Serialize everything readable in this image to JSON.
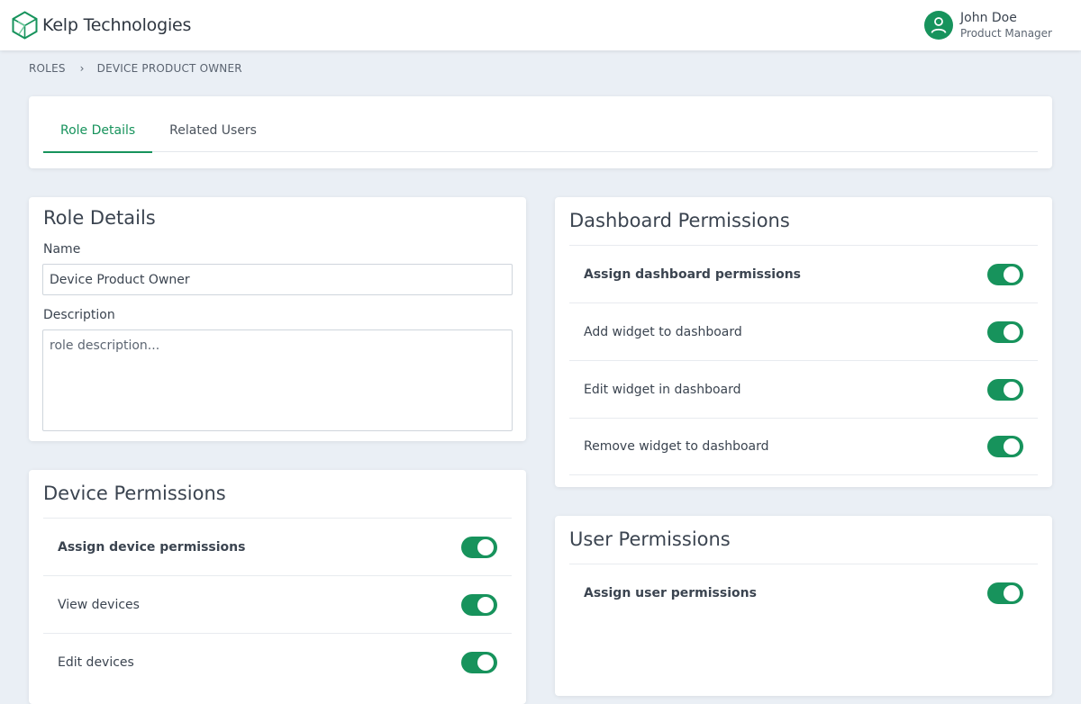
{
  "brand": {
    "name": "Kelp Technologies",
    "color": "#17935c"
  },
  "user": {
    "name": "John Doe",
    "title": "Product Manager",
    "icon": "user-avatar-icon"
  },
  "breadcrumb": {
    "items": [
      "ROLES",
      "DEVICE PRODUCT OWNER"
    ],
    "separator": "›"
  },
  "tabs": [
    {
      "label": "Role Details",
      "active": true
    },
    {
      "label": "Related Users",
      "active": false
    }
  ],
  "role_details": {
    "title": "Role Details",
    "name_label": "Name",
    "name_value": "Device Product Owner",
    "description_label": "Description",
    "description_placeholder": "role description..."
  },
  "device_permissions": {
    "title": "Device Permissions",
    "items": [
      {
        "label": "Assign device permissions",
        "enabled": true,
        "bold": true
      },
      {
        "label": "View devices",
        "enabled": true
      },
      {
        "label": "Edit devices",
        "enabled": true
      }
    ]
  },
  "dashboard_permissions": {
    "title": "Dashboard Permissions",
    "items": [
      {
        "label": "Assign dashboard permissions",
        "enabled": true,
        "bold": true
      },
      {
        "label": "Add widget to dashboard",
        "enabled": true
      },
      {
        "label": "Edit widget in dashboard",
        "enabled": true
      },
      {
        "label": "Remove widget to dashboard",
        "enabled": true
      }
    ]
  },
  "user_permissions": {
    "title": "User Permissions",
    "items": [
      {
        "label": "Assign user permissions",
        "enabled": true,
        "bold": true
      }
    ]
  }
}
